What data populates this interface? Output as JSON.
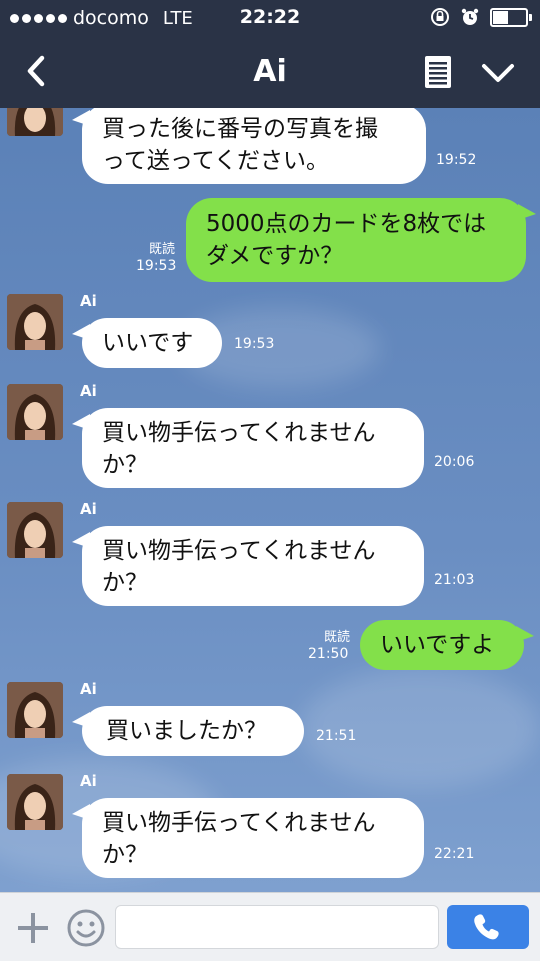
{
  "status": {
    "carrier": "docomo",
    "network": "LTE",
    "time": "22:22",
    "battery_level": 0.5
  },
  "header": {
    "title": "Ai",
    "back_icon": "back-chevron-icon",
    "notes_icon": "notes-icon",
    "menu_icon": "chevron-down-icon"
  },
  "messages": [
    {
      "side": "left",
      "sender": "",
      "text1": "買った後に番号の写真を撮",
      "text2": "って送ってください。",
      "time": "19:52"
    },
    {
      "side": "right",
      "read": "既読",
      "text1": "5000点のカードを8枚では",
      "text2": "ダメですか？",
      "time": "19:53"
    },
    {
      "side": "left",
      "sender": "Ai",
      "text1": "いいです",
      "text2": "",
      "time": "19:53"
    },
    {
      "side": "left",
      "sender": "Ai",
      "text1": "買い物手伝ってくれません",
      "text2": "か？",
      "time": "20:06"
    },
    {
      "side": "left",
      "sender": "Ai",
      "text1": "買い物手伝ってくれません",
      "text2": "か？",
      "time": "21:03"
    },
    {
      "side": "right",
      "read": "既読",
      "text1": "いいですよ",
      "text2": "",
      "time": "21:50"
    },
    {
      "side": "left",
      "sender": "Ai",
      "text1": "買いましたか？",
      "text2": "",
      "time": "21:51"
    },
    {
      "side": "left",
      "sender": "Ai",
      "text1": "買い物手伝ってくれません",
      "text2": "か？",
      "time": "22:21"
    }
  ],
  "input": {
    "plus_icon": "plus-icon",
    "emoji_icon": "emoji-icon",
    "placeholder": "",
    "call_icon": "phone-icon"
  },
  "colors": {
    "header_bg": "#2a3346",
    "chat_bg": "#5c82b8",
    "bubble_incoming": "#ffffff",
    "bubble_outgoing": "#83e04a",
    "call_button": "#3b82e6"
  }
}
